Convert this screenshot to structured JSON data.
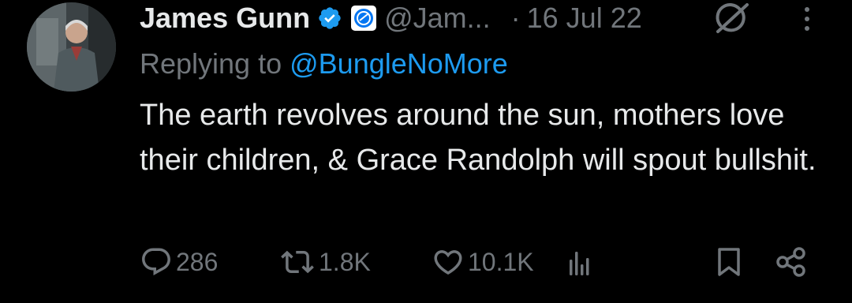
{
  "author": {
    "name": "James Gunn",
    "handle": "@Jam...",
    "verified_icon": "verified-badge-icon",
    "affiliation_icon": "dc-logo-icon",
    "avatar_icon": "profile-photo"
  },
  "meta": {
    "separator": "·",
    "date": "16 Jul 22"
  },
  "reply": {
    "prefix": "Replying to",
    "mention": "@BungleNoMore"
  },
  "tweet": {
    "text": "The earth revolves around the sun, mothers love their children, & Grace Randolph will spout bullshit."
  },
  "actions": {
    "replies": "286",
    "reposts": "1.8K",
    "likes": "10.1K"
  },
  "colors": {
    "background": "#000000",
    "text": "#e7e9ea",
    "muted": "#71767b",
    "accent": "#1d9bf0"
  }
}
